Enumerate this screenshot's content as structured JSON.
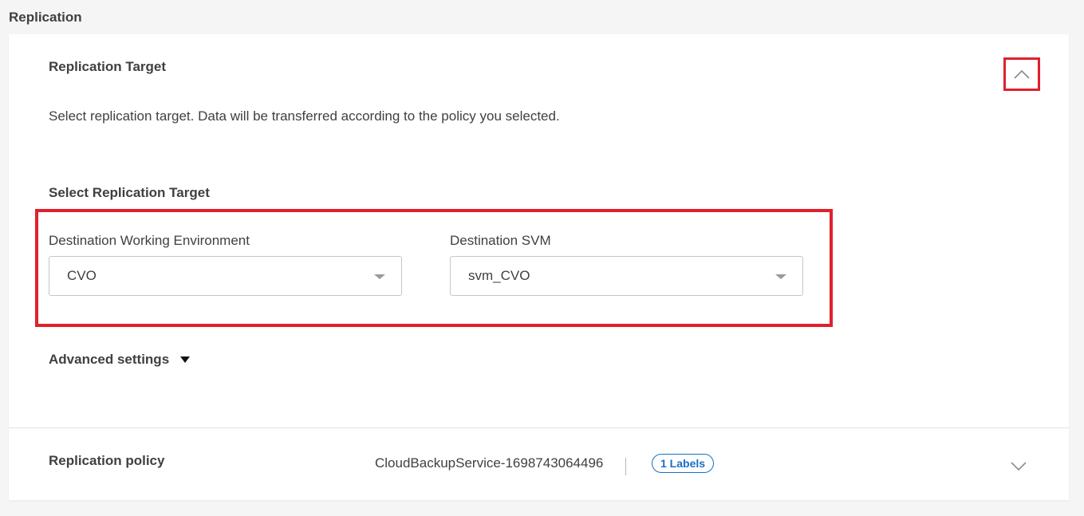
{
  "page": {
    "title": "Replication"
  },
  "target": {
    "title": "Replication Target",
    "description": "Select replication target. Data will be transferred according to the policy you selected.",
    "subtitle": "Select Replication Target",
    "collapse_icon": "chevron-up-icon",
    "fields": {
      "environment": {
        "label": "Destination Working Environment",
        "value": "CVO"
      },
      "svm": {
        "label": "Destination SVM",
        "value": "svm_CVO"
      }
    },
    "advanced_label": "Advanced settings"
  },
  "policy": {
    "title": "Replication policy",
    "name": "CloudBackupService-1698743064496",
    "labels_badge": "1 Labels",
    "expand_icon": "chevron-down-icon"
  },
  "colors": {
    "highlight": "#e0202c",
    "accent": "#1a6fc4",
    "text": "#404040"
  }
}
